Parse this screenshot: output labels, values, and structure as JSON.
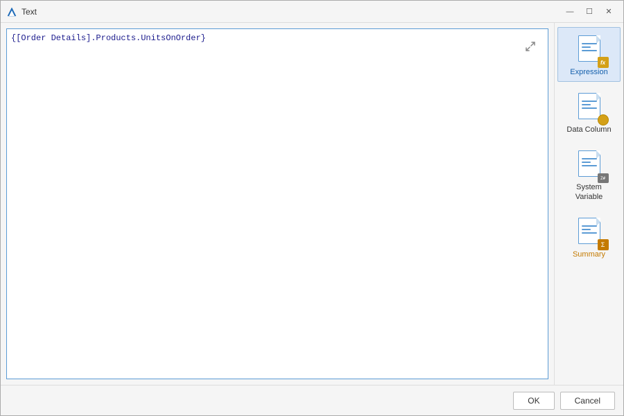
{
  "dialog": {
    "title": "Text",
    "title_icon": "document-icon"
  },
  "title_controls": {
    "minimize": "—",
    "maximize": "☐",
    "close": "✕"
  },
  "editor": {
    "content": "{[Order Details].Products.UnitsOnOrder}",
    "placeholder": ""
  },
  "right_panel": {
    "buttons": [
      {
        "id": "expression",
        "label": "Expression",
        "active": true
      },
      {
        "id": "data-column",
        "label": "Data Column",
        "active": false
      },
      {
        "id": "system-variable",
        "label": "System Variable",
        "active": false
      },
      {
        "id": "summary",
        "label": "Summary",
        "active": false,
        "highlight": true
      }
    ]
  },
  "footer": {
    "ok_label": "OK",
    "cancel_label": "Cancel"
  }
}
